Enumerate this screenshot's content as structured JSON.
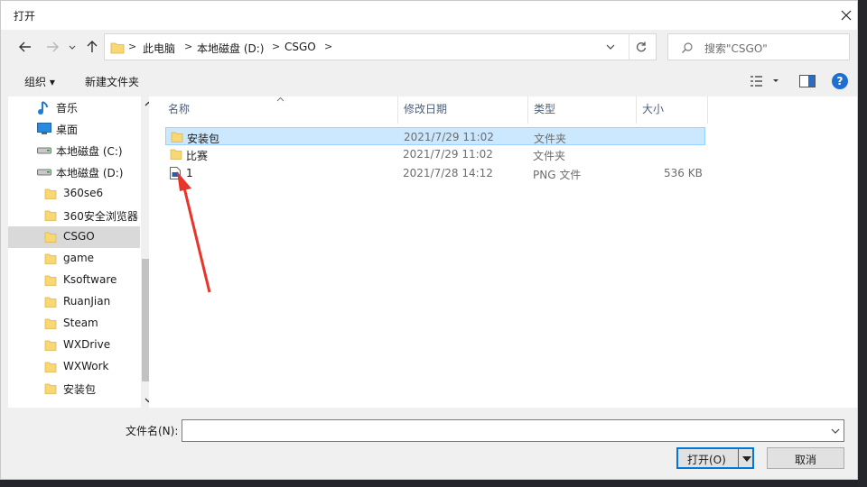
{
  "window": {
    "title": "打开"
  },
  "address": {
    "crumbs": [
      "此电脑",
      "本地磁盘 (D:)",
      "CSGO"
    ]
  },
  "search": {
    "placeholder": "搜索\"CSGO\""
  },
  "toolbar": {
    "organize": "组织 ▾",
    "new_folder": "新建文件夹"
  },
  "nav": {
    "items": [
      {
        "label": "音乐",
        "icon": "music-icon"
      },
      {
        "label": "桌面",
        "icon": "desktop-icon"
      },
      {
        "label": "本地磁盘 (C:)",
        "icon": "drive-icon"
      },
      {
        "label": "本地磁盘 (D:)",
        "icon": "drive-icon"
      },
      {
        "label": "360se6",
        "icon": "folder-icon"
      },
      {
        "label": "360安全浏览器",
        "icon": "folder-icon"
      },
      {
        "label": "CSGO",
        "icon": "folder-icon",
        "selected": true
      },
      {
        "label": "game",
        "icon": "folder-icon"
      },
      {
        "label": "Ksoftware",
        "icon": "folder-icon"
      },
      {
        "label": "RuanJian",
        "icon": "folder-icon"
      },
      {
        "label": "Steam",
        "icon": "folder-icon"
      },
      {
        "label": "WXDrive",
        "icon": "folder-icon"
      },
      {
        "label": "WXWork",
        "icon": "folder-icon"
      },
      {
        "label": "安装包",
        "icon": "folder-icon"
      }
    ]
  },
  "list": {
    "columns": [
      "名称",
      "修改日期",
      "类型",
      "大小"
    ],
    "rows": [
      {
        "name": "安装包",
        "date": "2021/7/29 11:02",
        "type": "文件夹",
        "size": "",
        "icon": "folder-icon",
        "selected": true
      },
      {
        "name": "比赛",
        "date": "2021/7/29 11:02",
        "type": "文件夹",
        "size": "",
        "icon": "folder-icon"
      },
      {
        "name": "1",
        "date": "2021/7/28 14:12",
        "type": "PNG 文件",
        "size": "536 KB",
        "icon": "image-file-icon"
      }
    ]
  },
  "bottom": {
    "filename_label": "文件名(N):",
    "filename_value": "",
    "open_label": "打开(O)",
    "cancel_label": "取消"
  },
  "colors": {
    "accent": "#0078d7",
    "selection": "#cce8ff",
    "folder": "#f8d775",
    "annotation_arrow": "#e8342a"
  }
}
